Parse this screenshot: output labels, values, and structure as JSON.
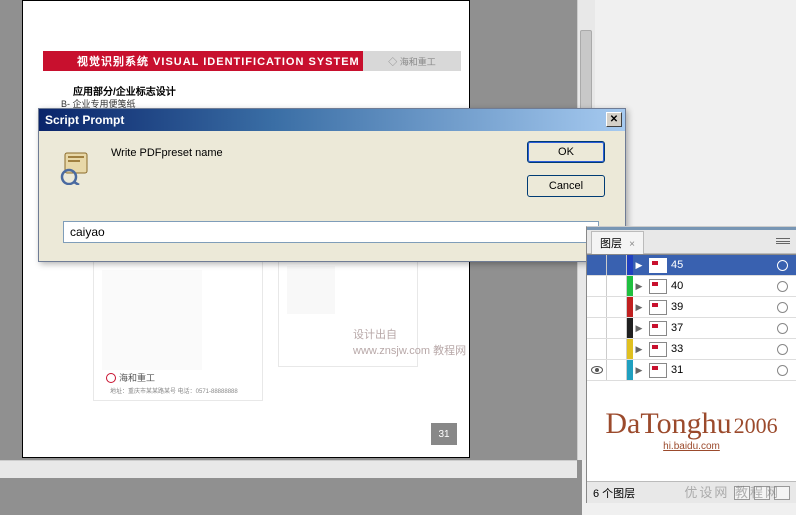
{
  "document": {
    "red_bar": "视觉识别系统  VISUAL IDENTIFICATION SYSTEM",
    "gray_bar": "◇ 海和重工",
    "subtitle1": "应用部分/企业标志设计",
    "subtitle2": "B- 企业专用便笺纸",
    "logo_text": "海和重工",
    "logo_small": "地址：重庆市某某路某号  电话：0571-88888888",
    "page_num": "31",
    "watermark": "设计出自 www.znsjw.com 教程网"
  },
  "dialog": {
    "title": "Script Prompt",
    "message": "Write PDFpreset name",
    "ok_label": "OK",
    "cancel_label": "Cancel",
    "input_value": "caiyao"
  },
  "layers_panel": {
    "tab": "图层",
    "rows": [
      {
        "name": "45",
        "color": "#2040c0",
        "selected": true,
        "visible": false
      },
      {
        "name": "40",
        "color": "#20c040",
        "selected": false,
        "visible": false
      },
      {
        "name": "39",
        "color": "#c02020",
        "selected": false,
        "visible": false
      },
      {
        "name": "37",
        "color": "#202020",
        "selected": false,
        "visible": false
      },
      {
        "name": "33",
        "color": "#e0c020",
        "selected": false,
        "visible": false
      },
      {
        "name": "31",
        "color": "#20a0c0",
        "selected": false,
        "visible": true
      }
    ],
    "signature": "DaTonghu",
    "signature_year": "2006",
    "signature_url": "hi.baidu.com",
    "status": "6 个图层"
  },
  "bottom_watermark": "优设网  教程网"
}
